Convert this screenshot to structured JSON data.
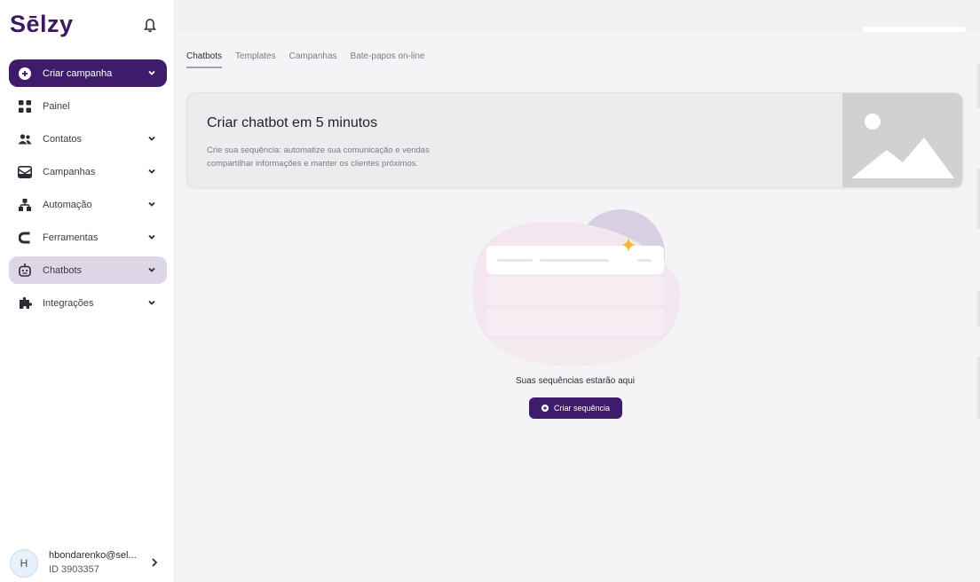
{
  "sidebar": {
    "logo": "Sēlzy",
    "items": [
      {
        "label": "Criar campanha",
        "icon": "plus-circle-icon"
      },
      {
        "label": "Painel",
        "icon": "grid-icon"
      },
      {
        "label": "Contatos",
        "icon": "people-icon"
      },
      {
        "label": "Campanhas",
        "icon": "mail-icon"
      },
      {
        "label": "Automação",
        "icon": "hierarchy-icon"
      },
      {
        "label": "Ferramentas",
        "icon": "magnet-icon"
      },
      {
        "label": "Chatbots",
        "icon": "robot-icon"
      },
      {
        "label": "Integrações",
        "icon": "puzzle-icon"
      }
    ],
    "user": {
      "initial": "H",
      "email": "hbondarenko@sel...",
      "id": "ID 3903357"
    }
  },
  "tabs": [
    "Chatbots",
    "Templates",
    "Campanhas",
    "Bate-papos on-line"
  ],
  "banner": {
    "title": "Criar chatbot em 5 minutos",
    "description": "Crie sua sequência: automatize sua comunicação e vendas compartilhar informações e manter os clientes próximos."
  },
  "empty_state": {
    "text": "Suas sequências estarão aqui",
    "button_label": "Criar sequência"
  },
  "colors": {
    "brand": "#3f1b6b",
    "active_item": "#ddd6e6",
    "star": "#f5b731"
  }
}
